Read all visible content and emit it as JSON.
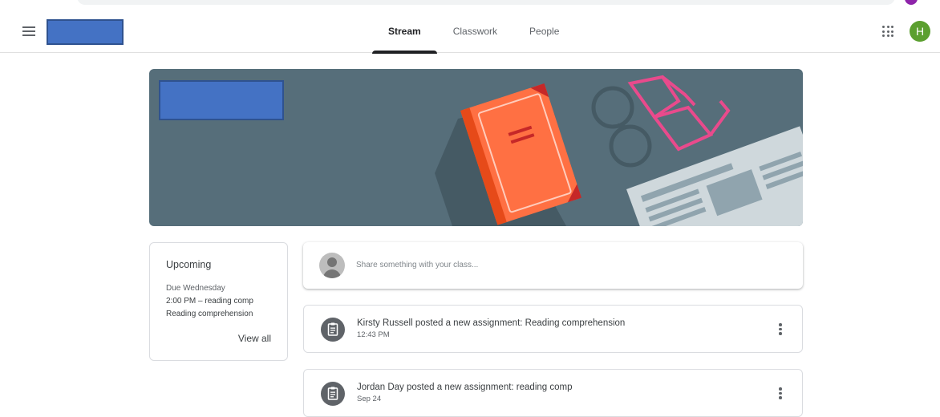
{
  "header": {
    "tabs": [
      {
        "label": "Stream",
        "active": true
      },
      {
        "label": "Classwork",
        "active": false
      },
      {
        "label": "People",
        "active": false
      }
    ],
    "menu_icon": "hamburger-menu-icon",
    "apps_icon": "google-apps-grid-icon",
    "avatar_letter": "H",
    "avatar_color": "#5b9f2f"
  },
  "colors": {
    "banner": "#566e7a",
    "redaction": "#4472c4",
    "book": "#ff7043",
    "glasses": "#e94a8c"
  },
  "upcoming": {
    "title": "Upcoming",
    "due": "Due Wednesday",
    "item_time": "2:00 PM – reading comp",
    "item_name": "Reading comprehension",
    "view_all": "View all"
  },
  "share": {
    "placeholder": "Share something with your class..."
  },
  "posts": [
    {
      "title": "Kirsty Russell posted a new assignment: Reading comprehension",
      "date": "12:43 PM",
      "icon": "assignment-icon"
    },
    {
      "title": "Jordan Day posted a new assignment: reading comp",
      "date": "Sep 24",
      "icon": "assignment-icon"
    }
  ]
}
